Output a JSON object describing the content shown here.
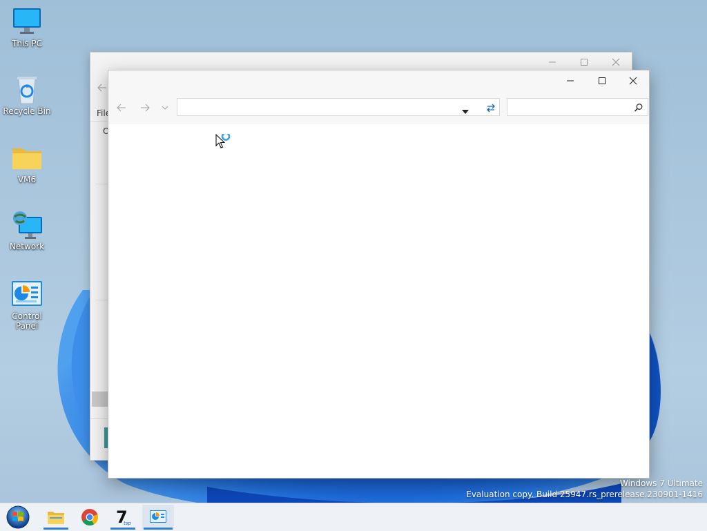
{
  "desktop": {
    "icons": [
      {
        "label": "This PC",
        "icon": "monitor-icon"
      },
      {
        "label": "Recycle Bin",
        "icon": "recycle-bin-icon"
      },
      {
        "label": "VM6",
        "icon": "folder-icon"
      },
      {
        "label": "Network",
        "icon": "network-icon"
      },
      {
        "label": "Control Panel",
        "icon": "control-panel-icon"
      }
    ]
  },
  "back_window": {
    "menu_fragment": "File",
    "text_fragment": "O"
  },
  "front_window": {
    "address_value": "",
    "search_placeholder": ""
  },
  "watermark": {
    "line1_prefix": "Windows 7 ",
    "line1_edition": "Ultimate",
    "line2": "Evaluation copy. Build 25947.rs_prerelease.230901-1416"
  },
  "taskbar": {
    "items": [
      {
        "icon": "start-orb-icon"
      },
      {
        "icon": "file-explorer-icon",
        "running": true
      },
      {
        "icon": "chrome-icon"
      },
      {
        "icon": "7tsp-icon",
        "running": true
      },
      {
        "icon": "control-panel-icon",
        "running": true,
        "active": true
      }
    ]
  },
  "colors": {
    "accent": "#2f7fd2",
    "desktop_bg": "#a9c6dd",
    "bloom": "#1565d8"
  }
}
